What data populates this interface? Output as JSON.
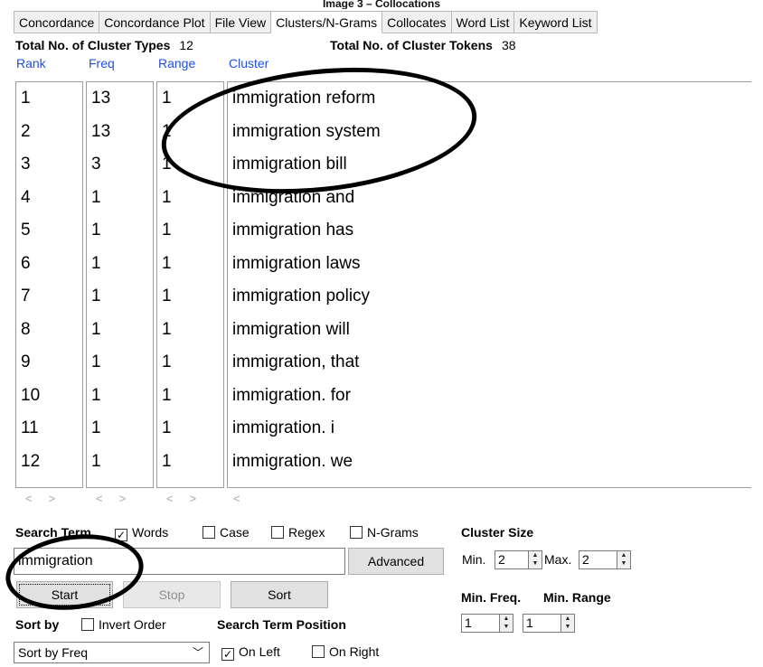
{
  "caption": "Image 3 – Collocations",
  "tabs": [
    "Concordance",
    "Concordance Plot",
    "File View",
    "Clusters/N-Grams",
    "Collocates",
    "Word List",
    "Keyword List"
  ],
  "active_tab_index": 3,
  "stats": {
    "types_label": "Total No. of Cluster Types",
    "types_value": "12",
    "tokens_label": "Total No. of Cluster Tokens",
    "tokens_value": "38"
  },
  "columns": {
    "rank": "Rank",
    "freq": "Freq",
    "range": "Range",
    "cluster": "Cluster"
  },
  "rows": [
    {
      "rank": "1",
      "freq": "13",
      "range": "1",
      "cluster": "immigration reform"
    },
    {
      "rank": "2",
      "freq": "13",
      "range": "1",
      "cluster": "immigration system"
    },
    {
      "rank": "3",
      "freq": "3",
      "range": "1",
      "cluster": "immigration bill"
    },
    {
      "rank": "4",
      "freq": "1",
      "range": "1",
      "cluster": "immigration and"
    },
    {
      "rank": "5",
      "freq": "1",
      "range": "1",
      "cluster": "immigration has"
    },
    {
      "rank": "6",
      "freq": "1",
      "range": "1",
      "cluster": "immigration laws"
    },
    {
      "rank": "7",
      "freq": "1",
      "range": "1",
      "cluster": "immigration policy"
    },
    {
      "rank": "8",
      "freq": "1",
      "range": "1",
      "cluster": "immigration will"
    },
    {
      "rank": "9",
      "freq": "1",
      "range": "1",
      "cluster": "immigration, that"
    },
    {
      "rank": "10",
      "freq": "1",
      "range": "1",
      "cluster": "immigration. for"
    },
    {
      "rank": "11",
      "freq": "1",
      "range": "1",
      "cluster": "immigration. i"
    },
    {
      "rank": "12",
      "freq": "1",
      "range": "1",
      "cluster": "immigration. we"
    }
  ],
  "scroll_arrows": {
    "left": "<",
    "right": ">"
  },
  "search": {
    "label": "Search Term",
    "words_label": "Words",
    "words_checked": true,
    "case_label": "Case",
    "case_checked": false,
    "regex_label": "Regex",
    "regex_checked": false,
    "ngrams_label": "N-Grams",
    "ngrams_checked": false,
    "value": "immigration",
    "advanced_label": "Advanced"
  },
  "buttons": {
    "start": "Start",
    "stop": "Stop",
    "sort": "Sort"
  },
  "cluster_size": {
    "label": "Cluster Size",
    "min_label": "Min.",
    "min_value": "2",
    "max_label": "Max.",
    "max_value": "2"
  },
  "min_freq": {
    "label": "Min. Freq.",
    "value": "1"
  },
  "min_range": {
    "label": "Min. Range",
    "value": "1"
  },
  "sort": {
    "label": "Sort by",
    "invert_label": "Invert Order",
    "invert_checked": false,
    "selected": "Sort by Freq"
  },
  "position": {
    "label": "Search Term Position",
    "left_label": "On Left",
    "left_checked": true,
    "right_label": "On Right",
    "right_checked": false
  },
  "icons": {
    "check": "✓",
    "chevron": "﹀",
    "spin_up": "▲",
    "spin_down": "▼"
  }
}
